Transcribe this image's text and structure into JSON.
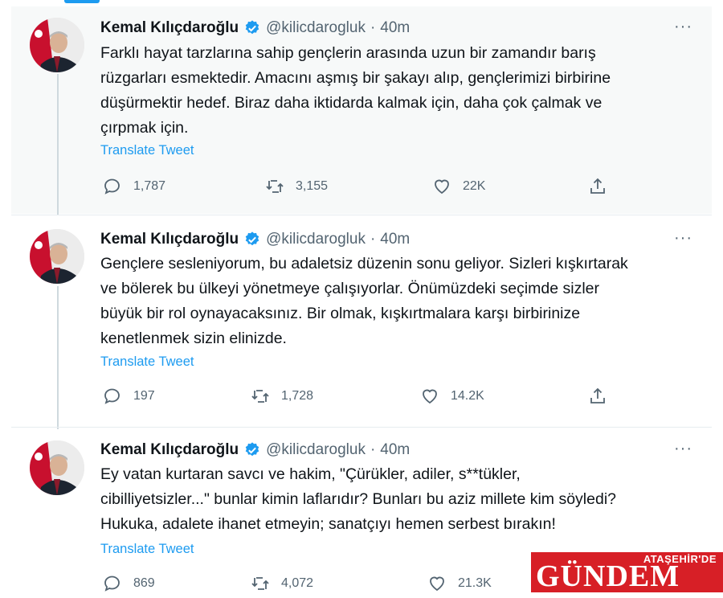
{
  "colors": {
    "accent": "#1d9bf0",
    "verified": "#1d9bf0",
    "logo_bg": "#d71f26"
  },
  "tweets": [
    {
      "author": "Kemal Kılıçdaroğlu",
      "handle": "@kilicdarogluk",
      "separator": "·",
      "time": "40m",
      "more": "···",
      "text_lines": [
        "Farklı hayat tarzlarına sahip gençlerin arasında uzun bir zamandır barış",
        "rüzgarları esmektedir. Amacını aşmış bir şakayı alıp, gençlerimizi birbirine",
        "düşürmektir hedef. Biraz daha iktidarda kalmak için, daha çok çalmak ve",
        "çırpmak için."
      ],
      "translate": "Translate Tweet",
      "replies": "1,787",
      "retweets": "3,155",
      "likes": "22K"
    },
    {
      "author": "Kemal Kılıçdaroğlu",
      "handle": "@kilicdarogluk",
      "separator": "·",
      "time": "40m",
      "more": "···",
      "text_lines": [
        "Gençlere sesleniyorum, bu adaletsiz düzenin sonu geliyor. Sizleri kışkırtarak",
        "ve bölerek bu ülkeyi yönetmeye çalışıyorlar. Önümüzdeki seçimde sizler",
        "büyük bir rol oynayacaksınız. Bir olmak, kışkırtmalara karşı birbirinize",
        "kenetlenmek sizin elinizde."
      ],
      "translate": "Translate Tweet",
      "replies": "197",
      "retweets": "1,728",
      "likes": "14.2K"
    },
    {
      "author": "Kemal Kılıçdaroğlu",
      "handle": "@kilicdarogluk",
      "separator": "·",
      "time": "40m",
      "more": "···",
      "text_lines": [
        "Ey vatan kurtaran savcı ve hakim, \"Çürükler, adiler, s**tükler,",
        "cibilliyetsizler...\" bunlar kimin laflarıdır? Bunları bu aziz millete kim söyledi?",
        "Hukuka, adalete ihanet etmeyin; sanatçıyı hemen serbest bırakın!"
      ],
      "translate": "Translate Tweet",
      "replies": "869",
      "retweets": "4,072",
      "likes": "21.3K"
    }
  ],
  "watermark": {
    "top": "ATAŞEHİR'DE",
    "main": "GÜNDEM"
  }
}
